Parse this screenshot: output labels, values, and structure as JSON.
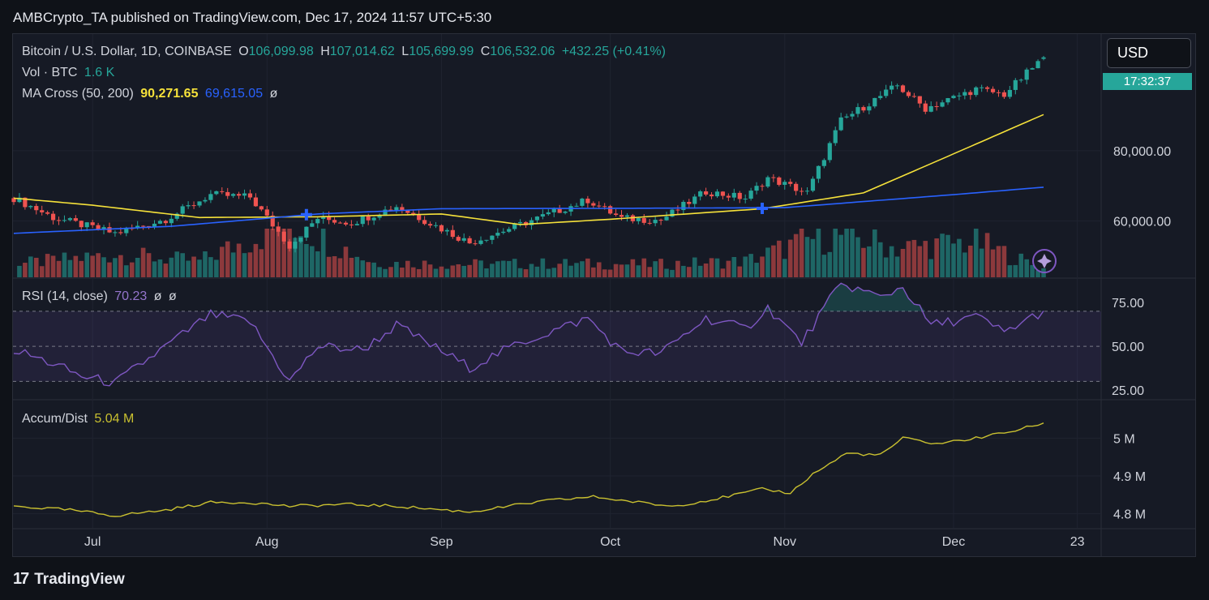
{
  "header": {
    "publisher_text": "AMBCrypto_TA published on TradingView.com, Dec 17, 2024 11:57 UTC+5:30"
  },
  "legend": {
    "symbol": "Bitcoin / U.S. Dollar, 1D, COINBASE",
    "o_label": "O",
    "o_value": "106,099.98",
    "h_label": "H",
    "h_value": "107,014.62",
    "l_label": "L",
    "l_value": "105,699.99",
    "c_label": "C",
    "c_value": "106,532.06",
    "change": "+432.25 (+0.41%)",
    "vol_label": "Vol · BTC",
    "vol_value": "1.6 K",
    "ma_label": "MA Cross (50, 200)",
    "ma50_value": "90,271.65",
    "ma200_value": "69,615.05",
    "ma_extra": "ø",
    "rsi_label": "RSI (14, close)",
    "rsi_value": "70.23",
    "rsi_extra1": "ø",
    "rsi_extra2": "ø",
    "ad_label": "Accum/Dist",
    "ad_value": "5.04 M"
  },
  "price_scale": {
    "currency_button": "USD",
    "countdown": "17:32:37"
  },
  "footer": {
    "brand": "TradingView",
    "logo_text": "17"
  },
  "colors": {
    "up": "#26a69a",
    "down": "#ef5350",
    "ma50": "#f5e13a",
    "ma200": "#2962ff",
    "rsi": "#7e57c2",
    "ad": "#c9c030",
    "background": "#161a25"
  },
  "chart_data": [
    {
      "type": "candlestick",
      "title": "Bitcoin / U.S. Dollar, 1D, COINBASE",
      "ylim": [
        44000,
        112000
      ],
      "y_ticks": [
        60000,
        80000
      ],
      "y_tick_labels": [
        "60,000.00",
        "80,000.00"
      ],
      "x_tick_labels": [
        "Jul",
        "Aug",
        "Sep",
        "Oct",
        "Nov",
        "Dec",
        "23"
      ],
      "x_range": [
        "2024-06-17",
        "2024-12-17"
      ],
      "x_tick_dates": [
        "2024-07-01",
        "2024-08-01",
        "2024-09-01",
        "2024-10-01",
        "2024-11-01",
        "2024-12-01",
        "2024-12-23"
      ],
      "close_anchors": [
        [
          "2024-06-17",
          66500
        ],
        [
          "2024-06-24",
          61000
        ],
        [
          "2024-07-05",
          56500
        ],
        [
          "2024-07-14",
          60500
        ],
        [
          "2024-07-22",
          67500
        ],
        [
          "2024-07-29",
          66800
        ],
        [
          "2024-08-05",
          53000
        ],
        [
          "2024-08-10",
          60800
        ],
        [
          "2024-08-16",
          59500
        ],
        [
          "2024-08-24",
          64200
        ],
        [
          "2024-09-06",
          53800
        ],
        [
          "2024-09-15",
          59000
        ],
        [
          "2024-09-27",
          66000
        ],
        [
          "2024-10-03",
          60700
        ],
        [
          "2024-10-10",
          60300
        ],
        [
          "2024-10-18",
          68400
        ],
        [
          "2024-10-25",
          66500
        ],
        [
          "2024-10-29",
          72300
        ],
        [
          "2024-11-05",
          68000
        ],
        [
          "2024-11-11",
          88500
        ],
        [
          "2024-11-21",
          98500
        ],
        [
          "2024-11-26",
          92000
        ],
        [
          "2024-12-05",
          97500
        ],
        [
          "2024-12-10",
          96000
        ],
        [
          "2024-12-17",
          106532
        ]
      ],
      "series": [
        {
          "name": "MA 50",
          "anchors": [
            [
              "2024-06-17",
              66500
            ],
            [
              "2024-07-01",
              64500
            ],
            [
              "2024-07-20",
              61000
            ],
            [
              "2024-08-10",
              61200
            ],
            [
              "2024-09-01",
              62000
            ],
            [
              "2024-09-15",
              59000
            ],
            [
              "2024-10-01",
              60500
            ],
            [
              "2024-10-28",
              63500
            ],
            [
              "2024-11-15",
              68000
            ],
            [
              "2024-11-28",
              77000
            ],
            [
              "2024-12-17",
              90271.65
            ]
          ]
        },
        {
          "name": "MA 200",
          "anchors": [
            [
              "2024-06-17",
              56500
            ],
            [
              "2024-07-15",
              58500
            ],
            [
              "2024-08-10",
              62000
            ],
            [
              "2024-09-01",
              63500
            ],
            [
              "2024-10-01",
              63600
            ],
            [
              "2024-11-01",
              63800
            ],
            [
              "2024-12-01",
              67500
            ],
            [
              "2024-12-17",
              69615.05
            ]
          ]
        }
      ],
      "cross_markers": [
        [
          "2024-08-08",
          61800
        ],
        [
          "2024-10-28",
          63600
        ]
      ]
    },
    {
      "type": "line",
      "title": "RSI (14, close)",
      "ylim": [
        20,
        88
      ],
      "y_ticks": [
        25,
        50,
        75
      ],
      "y_tick_labels": [
        "25.00",
        "50.00",
        "75.00"
      ],
      "bands": [
        30,
        50,
        70
      ],
      "anchors": [
        [
          "2024-06-17",
          48
        ],
        [
          "2024-06-24",
          40
        ],
        [
          "2024-06-29",
          33
        ],
        [
          "2024-07-05",
          29
        ],
        [
          "2024-07-14",
          50
        ],
        [
          "2024-07-22",
          68
        ],
        [
          "2024-07-29",
          64
        ],
        [
          "2024-08-05",
          30
        ],
        [
          "2024-08-10",
          50
        ],
        [
          "2024-08-18",
          48
        ],
        [
          "2024-08-24",
          62
        ],
        [
          "2024-09-06",
          38
        ],
        [
          "2024-09-15",
          52
        ],
        [
          "2024-09-27",
          66
        ],
        [
          "2024-10-03",
          47
        ],
        [
          "2024-10-10",
          46
        ],
        [
          "2024-10-18",
          66
        ],
        [
          "2024-10-25",
          60
        ],
        [
          "2024-10-29",
          72
        ],
        [
          "2024-11-04",
          52
        ],
        [
          "2024-11-11",
          86
        ],
        [
          "2024-11-18",
          78
        ],
        [
          "2024-11-22",
          84
        ],
        [
          "2024-11-27",
          62
        ],
        [
          "2024-12-05",
          67
        ],
        [
          "2024-12-10",
          58
        ],
        [
          "2024-12-17",
          70.23
        ]
      ]
    },
    {
      "type": "line",
      "title": "Accum/Dist",
      "ylim": [
        4.765,
        5.095
      ],
      "y_ticks": [
        4.8,
        4.9,
        5.0
      ],
      "y_tick_labels": [
        "4.8 M",
        "4.9 M",
        "5 M"
      ],
      "anchors": [
        [
          "2024-06-17",
          4.82
        ],
        [
          "2024-06-27",
          4.81
        ],
        [
          "2024-07-05",
          4.795
        ],
        [
          "2024-07-14",
          4.81
        ],
        [
          "2024-07-22",
          4.83
        ],
        [
          "2024-07-29",
          4.83
        ],
        [
          "2024-08-05",
          4.82
        ],
        [
          "2024-08-15",
          4.825
        ],
        [
          "2024-08-24",
          4.82
        ],
        [
          "2024-09-06",
          4.805
        ],
        [
          "2024-09-20",
          4.835
        ],
        [
          "2024-09-28",
          4.845
        ],
        [
          "2024-10-06",
          4.83
        ],
        [
          "2024-10-12",
          4.82
        ],
        [
          "2024-10-20",
          4.84
        ],
        [
          "2024-10-28",
          4.865
        ],
        [
          "2024-11-02",
          4.855
        ],
        [
          "2024-11-06",
          4.905
        ],
        [
          "2024-11-12",
          4.96
        ],
        [
          "2024-11-18",
          4.955
        ],
        [
          "2024-11-22",
          5.0
        ],
        [
          "2024-11-28",
          4.985
        ],
        [
          "2024-12-05",
          5.0
        ],
        [
          "2024-12-12",
          5.02
        ],
        [
          "2024-12-17",
          5.04
        ]
      ]
    },
    {
      "type": "bar",
      "title": "Vol · BTC",
      "ylim": [
        0,
        24000
      ],
      "anchors": [
        [
          "2024-06-17",
          4000
        ],
        [
          "2024-07-05",
          7000
        ],
        [
          "2024-07-20",
          5000
        ],
        [
          "2024-08-05",
          17000
        ],
        [
          "2024-08-20",
          4500
        ],
        [
          "2024-09-06",
          4000
        ],
        [
          "2024-09-20",
          4200
        ],
        [
          "2024-10-10",
          4000
        ],
        [
          "2024-10-25",
          5000
        ],
        [
          "2024-11-06",
          12000
        ],
        [
          "2024-11-12",
          13000
        ],
        [
          "2024-11-21",
          9000
        ],
        [
          "2024-12-05",
          11000
        ],
        [
          "2024-12-17",
          2500
        ]
      ]
    }
  ]
}
